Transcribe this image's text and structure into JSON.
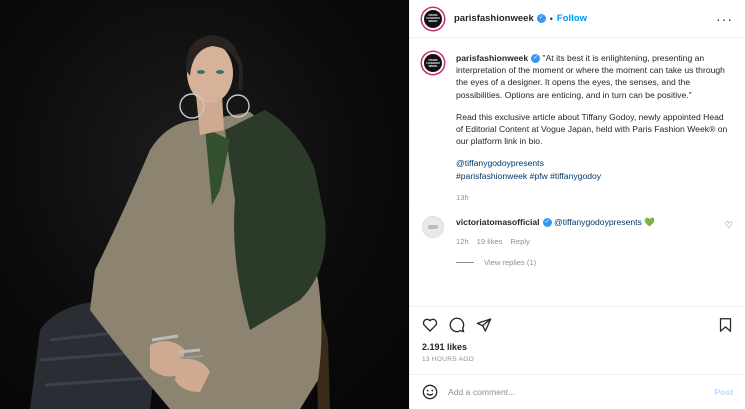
{
  "post": {
    "username": "parisfashionweek",
    "follow_label": "Follow",
    "avatar_text": [
      "PARIS",
      "FASHION",
      "WEEK"
    ],
    "caption_username": "parisfashionweek",
    "caption_p1": " \"At its best it is enlightening, presenting an interpretation of the moment or where the moment can take us through the eyes of a designer. It opens the eyes, the senses, and the possibilities. Options are enticing, and in turn can be positive.\"",
    "caption_p2": "Read this exclusive article about Tiffany Godoy, newly appointed Head of Editorial Content at Vogue Japan, held with Paris Fashion Week® on our platform link in bio.",
    "mention": "@tiffanygodoypresents",
    "hashtags": "#parisfashionweek #pfw #tiffanygodoy",
    "time": "13h"
  },
  "comment": {
    "username": "victoriatomasofficial",
    "mention": "@tiffanygodoypresents",
    "emoji": "💚",
    "time": "12h",
    "likes": "19 likes",
    "reply_label": "Reply",
    "view_replies": "View replies (1)"
  },
  "footer": {
    "likes": "2.191 likes",
    "ago": "13 HOURS AGO",
    "add_comment_placeholder": "Add a comment...",
    "post_label": "Post"
  },
  "colors": {
    "accent": "#0095f6",
    "verified": "#3897f0",
    "link": "#00376b",
    "muted": "#8e8e8e"
  },
  "icons": [
    "more-icon",
    "verified-icon",
    "heart-icon",
    "comment-icon",
    "share-icon",
    "save-icon",
    "emoji-icon"
  ]
}
